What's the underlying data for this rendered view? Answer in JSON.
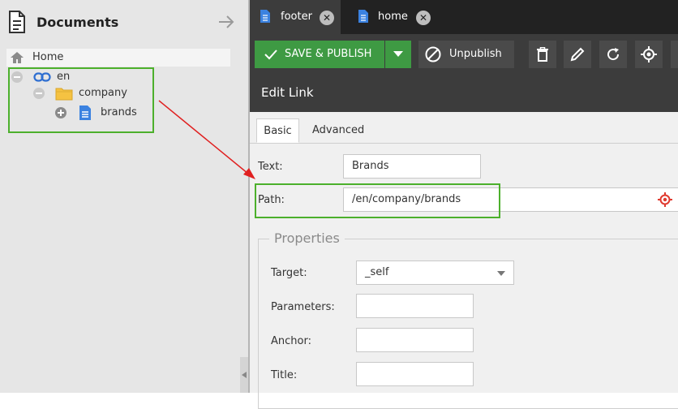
{
  "left_panel": {
    "title": "Documents",
    "tree": {
      "home": "Home",
      "en": "en",
      "company": "company",
      "brands": "brands"
    }
  },
  "tabs": [
    {
      "label": "footer",
      "active": true
    },
    {
      "label": "home",
      "active": false
    }
  ],
  "toolbar": {
    "save_publish": "SAVE & PUBLISH",
    "unpublish": "Unpublish"
  },
  "panel": {
    "title": "Edit Link",
    "subtabs": [
      "Basic",
      "Advanced"
    ],
    "text_label": "Text:",
    "text_value": "Brands",
    "path_label": "Path:",
    "path_value": "/en/company/brands",
    "properties": {
      "legend": "Properties",
      "target_label": "Target:",
      "target_value": "_self",
      "parameters_label": "Parameters:",
      "parameters_value": "",
      "anchor_label": "Anchor:",
      "anchor_value": "",
      "title_label": "Title:",
      "title_value": ""
    }
  },
  "colors": {
    "save_green": "#3e9a43",
    "highlight_green": "#4cb02c",
    "arrow_red": "#e02020",
    "dark_toolbar": "#3c3c3c"
  }
}
